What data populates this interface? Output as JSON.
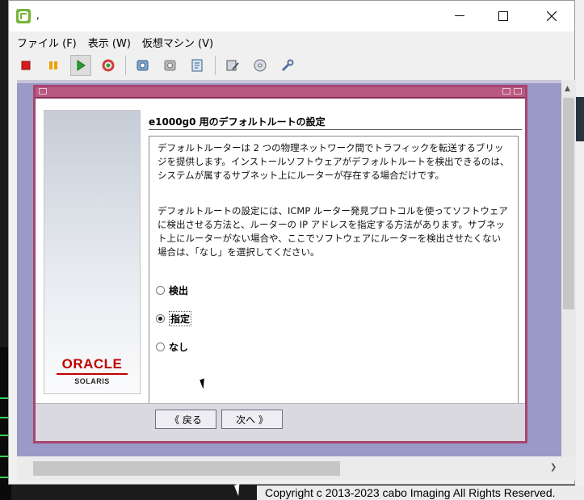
{
  "window": {
    "title": ","
  },
  "menu": [
    {
      "label": "ファイル (F)"
    },
    {
      "label": "表示 (W)"
    },
    {
      "label": "仮想マシン (V)"
    }
  ],
  "toolbar": [
    {
      "icon": "stop-icon",
      "color": "#d91b1b"
    },
    {
      "icon": "pause-icon",
      "color": "#f0a000"
    },
    {
      "icon": "play-icon",
      "color": "#22a02a"
    },
    {
      "icon": "restart-icon",
      "color": "#d33c3c"
    },
    {
      "icon": "snapshot-take-icon"
    },
    {
      "icon": "snapshot-revert-icon"
    },
    {
      "icon": "snapshot-manager-icon"
    },
    {
      "icon": "edit-settings-icon"
    },
    {
      "icon": "cd-drive-icon"
    },
    {
      "icon": "tools-icon"
    }
  ],
  "installer": {
    "heading": "e1000g0 用のデフォルトルートの設定",
    "paragraph1": "デフォルトルーターは 2 つの物理ネットワーク間でトラフィックを転送するブリッジを提供します。インストールソフトウェアがデフォルトルートを検出できるのは、システムが属するサブネット上にルーターが存在する場合だけです。",
    "paragraph2": "デフォルトルートの設定には、ICMP ルーター発見プロトコルを使ってソフトウェアに検出させる方法と、ルーターの IP アドレスを指定する方法があります。サブネット上にルーターがない場合や、ここでソフトウェアにルーターを検出させたくない場合は、「なし」を選択してください。",
    "options": [
      {
        "label": "検出",
        "selected": false
      },
      {
        "label": "指定",
        "selected": true
      },
      {
        "label": "なし",
        "selected": false
      }
    ],
    "back_label": "《 戻る",
    "next_label": "次へ 》",
    "logo_brand": "ORACLE",
    "logo_product": "SOLARIS"
  },
  "footer": {
    "copyright": "Copyright c 2013-2023 cabo Imaging All Rights Reserved."
  },
  "colors": {
    "accent": "#a8456e",
    "vm_background": "#9b99c8",
    "logo_red": "#c00000"
  }
}
